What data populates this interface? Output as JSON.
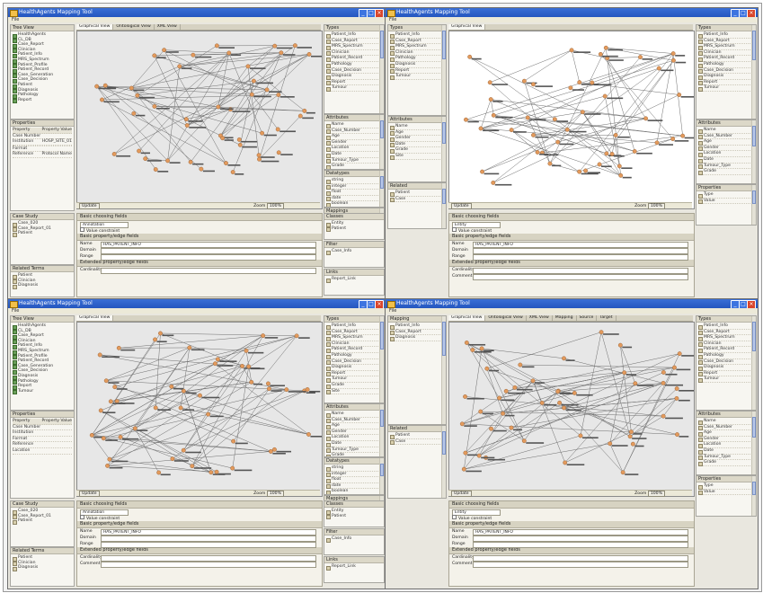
{
  "windows": [
    {
      "title": "HealthAgents Mapping Tool",
      "menu": "File",
      "left": {
        "tree_tab": "Tree View",
        "tree": [
          "HealthAgents",
          "CL_DB",
          "Case_Report",
          "Clinician",
          "Patient_Info",
          "MRS_Spectrum",
          "Patient_Profile",
          "Patient_Record",
          "Case_Generation",
          "Case_Decision",
          "Patient",
          "Diagnosis",
          "Pathology",
          "Report"
        ],
        "props_tab": "Properties",
        "props_headers": [
          "Property",
          "Property Value"
        ],
        "props": [
          [
            "Case Number",
            ""
          ],
          [
            "Institution",
            "HOSP_SITE_01"
          ],
          [
            "",
            ""
          ],
          [
            "Format",
            ""
          ],
          [
            "Reference",
            "Protocol Name"
          ]
        ],
        "bottom_tab": "Case Study",
        "bottom_rows": [
          "Case_020",
          "Case_Report_01",
          "Patient"
        ],
        "bottom2_tab": "Related Terms",
        "bottom2_rows": [
          "Patient",
          "Clinician",
          "Diagnosis"
        ]
      },
      "canvas_tabs": [
        "Graphical View",
        "Ontological View",
        "XML View"
      ],
      "canvas_status": "Zoom",
      "canvas_zoom": "100%",
      "canvas_button": "Update",
      "right_panels": [
        {
          "title": "Types",
          "rows": [
            "Patient_Info",
            "Case_Report",
            "MRS_Spectrum",
            "Clinician",
            "Patient_Record",
            "Pathology",
            "Case_Decision",
            "Diagnosis",
            "Report",
            "Tumour"
          ]
        },
        {
          "title": "Attributes",
          "rows": [
            "Name",
            "Case_Number",
            "Age",
            "Gender",
            "Location",
            "Date",
            "Tumour_Type",
            "Grade",
            "Site"
          ]
        },
        {
          "title": "Datatypes",
          "rows": [
            "string",
            "integer",
            "float",
            "date",
            "boolean"
          ]
        },
        {
          "title": "Mappings",
          "rows": [
            "Patient",
            "Case",
            "Report"
          ]
        }
      ],
      "bottom_form": {
        "sec1": "Basic choosing fields",
        "sec1_value": "Annotation",
        "sec1_check": "Value constraint",
        "sec2": "Basic property/edge fields",
        "sec2_fields": [
          [
            "Name",
            "HAS_PATIENT_INFO"
          ],
          [
            "Domain",
            ""
          ],
          [
            "Range",
            ""
          ]
        ],
        "sec3": "Extended property/edge fields",
        "sec3_fields": [
          [
            "Cardinality",
            ""
          ]
        ]
      },
      "mini_panels": [
        {
          "title": "Classes",
          "rows": [
            "Entity",
            "Patient"
          ]
        },
        {
          "title": "Filter",
          "rows": [
            "Case_Info"
          ]
        },
        {
          "title": "Links",
          "rows": [
            "Report_Link"
          ]
        }
      ]
    },
    {
      "title": "HealthAgents Mapping Tool",
      "menu": "File",
      "canvas_tabs": [
        "Graphical View"
      ],
      "canvas_status": "Zoom",
      "canvas_zoom": "100%",
      "canvas_button": "Update",
      "right_panels": [
        {
          "title": "Types",
          "rows": [
            "Patient_Info",
            "Case_Report",
            "MRS_Spectrum",
            "Clinician",
            "Patient_Record",
            "Pathology",
            "Case_Decision",
            "Diagnosis",
            "Report",
            "Tumour"
          ]
        },
        {
          "title": "Attributes",
          "rows": [
            "Name",
            "Case_Number",
            "Age",
            "Gender",
            "Location",
            "Date",
            "Tumour_Type",
            "Grade"
          ]
        },
        {
          "title": "Properties",
          "rows": [
            "Type",
            "Value"
          ]
        }
      ],
      "left_panels": [
        {
          "title": "Types",
          "rows": [
            "Patient_Info",
            "Case_Report",
            "MRS_Spectrum",
            "Clinician",
            "Pathology",
            "Diagnosis",
            "Report",
            "Tumour"
          ]
        },
        {
          "title": "Attributes",
          "rows": [
            "Name",
            "Age",
            "Gender",
            "Date",
            "Grade",
            "Site"
          ]
        },
        {
          "title": "Related",
          "rows": [
            "Patient",
            "Case"
          ]
        }
      ],
      "bottom_form": {
        "sec1": "Basic choosing fields",
        "sec1_value": "Entity",
        "sec1_check": "Value constraint",
        "sec2": "Basic property/edge fields",
        "sec2_fields": [
          [
            "Name",
            "HAS_PATIENT_INFO"
          ],
          [
            "Domain",
            ""
          ],
          [
            "Range",
            ""
          ]
        ],
        "sec3": "Extended property/edge fields",
        "sec3_fields": [
          [
            "Cardinality",
            ""
          ],
          [
            "Comment",
            ""
          ]
        ]
      }
    },
    {
      "title": "HealthAgents Mapping Tool",
      "menu": "File",
      "left": {
        "tree_tab": "Tree View",
        "tree": [
          "HealthAgents",
          "CL_DB",
          "Case_Report",
          "Clinician",
          "Patient_Info",
          "MRS_Spectrum",
          "Patient_Profile",
          "Patient_Record",
          "Case_Generation",
          "Case_Decision",
          "Diagnosis",
          "Pathology",
          "Report",
          "Tumour"
        ],
        "props_tab": "Properties",
        "props_headers": [
          "Property",
          "Property Value"
        ],
        "props": [
          [
            "Case Number",
            ""
          ],
          [
            "Institution",
            ""
          ],
          [
            "Format",
            ""
          ],
          [
            "Reference",
            ""
          ],
          [
            "Location",
            ""
          ]
        ],
        "bottom_tab": "Case Study",
        "bottom_rows": [
          "Case_020",
          "Case_Report_01",
          "Patient"
        ],
        "bottom2_tab": "Related Terms",
        "bottom2_rows": [
          "Patient",
          "Clinician",
          "Diagnosis"
        ]
      },
      "canvas_tabs": [
        "Graphical View"
      ],
      "canvas_status": "Zoom",
      "canvas_zoom": "100%",
      "canvas_button": "Update",
      "right_panels": [
        {
          "title": "Types",
          "rows": [
            "Patient_Info",
            "Case_Report",
            "MRS_Spectrum",
            "Clinician",
            "Patient_Record",
            "Pathology",
            "Case_Decision",
            "Diagnosis",
            "Report",
            "Tumour",
            "Grade",
            "Site"
          ]
        },
        {
          "title": "Attributes",
          "rows": [
            "Name",
            "Case_Number",
            "Age",
            "Gender",
            "Location",
            "Date",
            "Tumour_Type",
            "Grade"
          ]
        },
        {
          "title": "Datatypes",
          "rows": [
            "string",
            "integer",
            "float",
            "date",
            "boolean"
          ]
        },
        {
          "title": "Mappings",
          "rows": [
            "Patient",
            "Case",
            "Report"
          ]
        }
      ],
      "bottom_form": {
        "sec1": "Basic choosing fields",
        "sec1_value": "Annotation",
        "sec1_check": "Value constraint",
        "sec2": "Basic property/edge fields",
        "sec2_fields": [
          [
            "Name",
            "HAS_PATIENT_INFO"
          ],
          [
            "Domain",
            ""
          ],
          [
            "Range",
            ""
          ]
        ],
        "sec3": "Extended property/edge fields",
        "sec3_fields": [
          [
            "Cardinality",
            ""
          ],
          [
            "Comment",
            ""
          ]
        ]
      },
      "mini_panels": [
        {
          "title": "Classes",
          "rows": [
            "Entity",
            "Patient"
          ]
        },
        {
          "title": "Filter",
          "rows": [
            "Case_Info"
          ]
        },
        {
          "title": "Links",
          "rows": [
            "Report_Link"
          ]
        }
      ]
    },
    {
      "title": "HealthAgents Mapping Tool",
      "menu": "File",
      "canvas_tabs": [
        "Graphical View",
        "Ontological View",
        "XML View",
        "Mapping",
        "Source",
        "Target"
      ],
      "canvas_status": "Zoom",
      "canvas_zoom": "100%",
      "canvas_button": "Update",
      "right_panels": [
        {
          "title": "Types",
          "rows": [
            "Patient_Info",
            "Case_Report",
            "MRS_Spectrum",
            "Clinician",
            "Patient_Record",
            "Pathology",
            "Case_Decision",
            "Diagnosis",
            "Report",
            "Tumour"
          ]
        },
        {
          "title": "Attributes",
          "rows": [
            "Name",
            "Case_Number",
            "Age",
            "Gender",
            "Location",
            "Date",
            "Tumour_Type",
            "Grade"
          ]
        },
        {
          "title": "Properties",
          "rows": [
            "Type",
            "Value"
          ]
        }
      ],
      "left_panels": [
        {
          "title": "Mapping",
          "rows": [
            "Patient_Info",
            "Case_Report",
            "Diagnosis"
          ]
        },
        {
          "title": "Related",
          "rows": [
            "Patient",
            "Case"
          ]
        }
      ],
      "bottom_form": {
        "sec1": "Basic choosing fields",
        "sec1_value": "Entity",
        "sec1_check": "Value constraint",
        "sec2": "Basic property/edge fields",
        "sec2_fields": [
          [
            "Name",
            "HAS_PATIENT_INFO"
          ],
          [
            "Domain",
            ""
          ],
          [
            "Range",
            ""
          ]
        ],
        "sec3": "Extended property/edge fields",
        "sec3_fields": [
          [
            "Cardinality",
            ""
          ],
          [
            "Comment",
            ""
          ]
        ]
      }
    }
  ],
  "colors": {
    "title_bar": "#2a5cc4",
    "node_orange": "#e39a5c",
    "canvas_gray": "#e7e7e7",
    "canvas_white": "#ffffff"
  }
}
